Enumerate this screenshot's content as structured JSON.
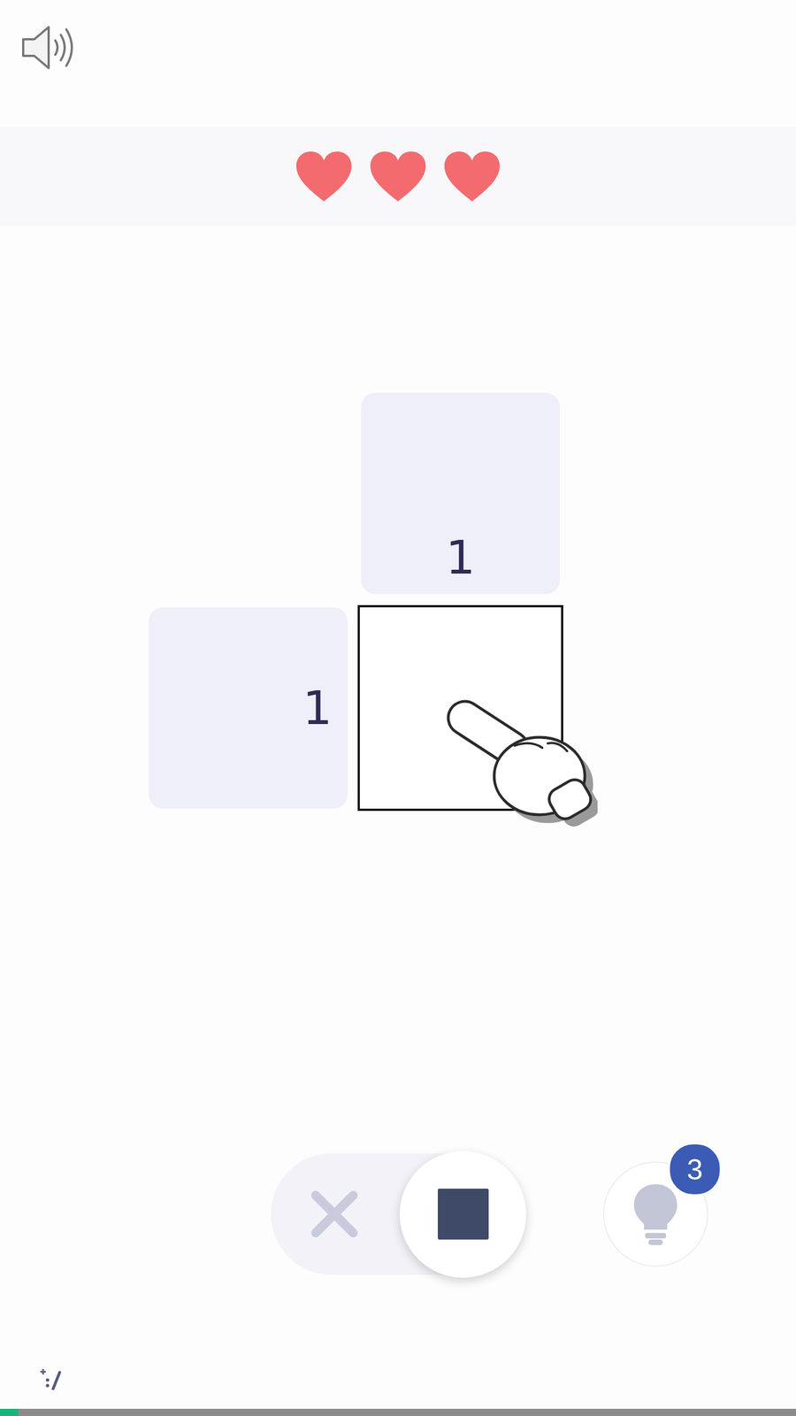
{
  "lives": [
    {
      "filled": true
    },
    {
      "filled": true
    },
    {
      "filled": true
    }
  ],
  "puzzle": {
    "column_clues": [
      "1"
    ],
    "row_clues": [
      "1"
    ],
    "cells": [
      {
        "filled": false,
        "crossed": false,
        "focused": true
      }
    ]
  },
  "mode_toggle": [
    {
      "kind": "cross",
      "selected": false
    },
    {
      "kind": "fill",
      "selected": true
    }
  ],
  "hint_button": {
    "badge": "3"
  },
  "progress": {
    "level": 0.023
  }
}
